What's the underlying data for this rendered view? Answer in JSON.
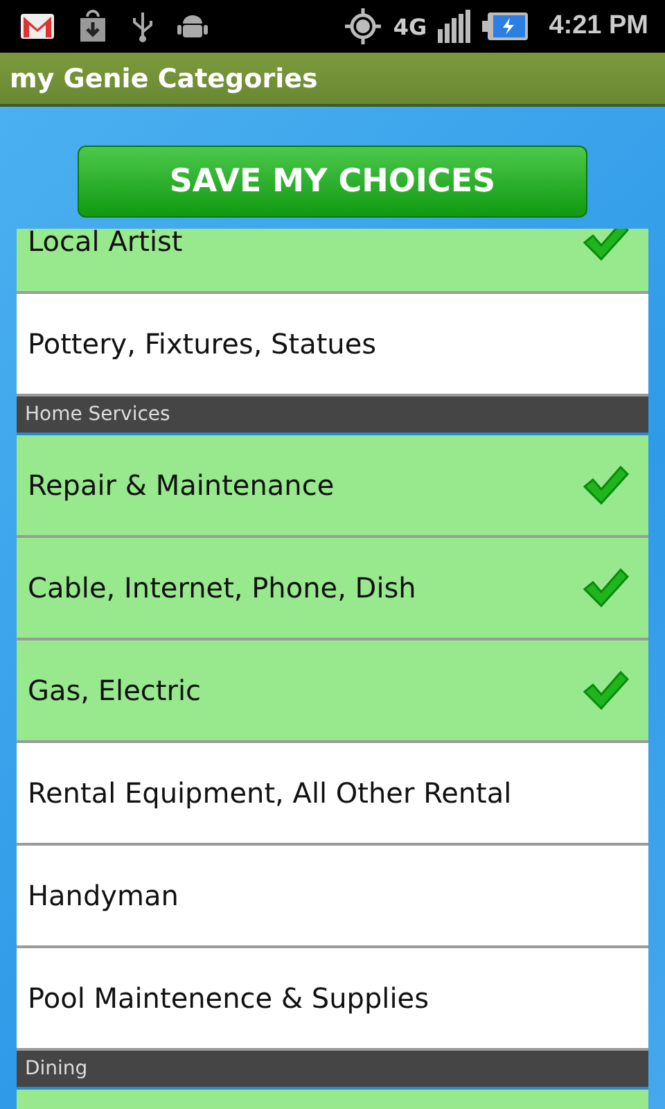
{
  "status_bar": {
    "network": "4G",
    "time": "4:21 PM"
  },
  "title": "my Genie Categories",
  "save_button": "SAVE MY CHOICES",
  "list": [
    {
      "kind": "item",
      "label": "Local Artist",
      "selected": true
    },
    {
      "kind": "item",
      "label": "Pottery, Fixtures, Statues",
      "selected": false
    },
    {
      "kind": "header",
      "label": "Home Services"
    },
    {
      "kind": "item",
      "label": "Repair & Maintenance",
      "selected": true
    },
    {
      "kind": "item",
      "label": "Cable, Internet, Phone, Dish",
      "selected": true
    },
    {
      "kind": "item",
      "label": "Gas, Electric",
      "selected": true
    },
    {
      "kind": "item",
      "label": "Rental Equipment, All Other Rental",
      "selected": false
    },
    {
      "kind": "item",
      "label": "Handyman",
      "selected": false
    },
    {
      "kind": "item",
      "label": "Pool Maintenence & Supplies",
      "selected": false
    },
    {
      "kind": "header",
      "label": "Dining"
    },
    {
      "kind": "item",
      "selected": true
    }
  ]
}
